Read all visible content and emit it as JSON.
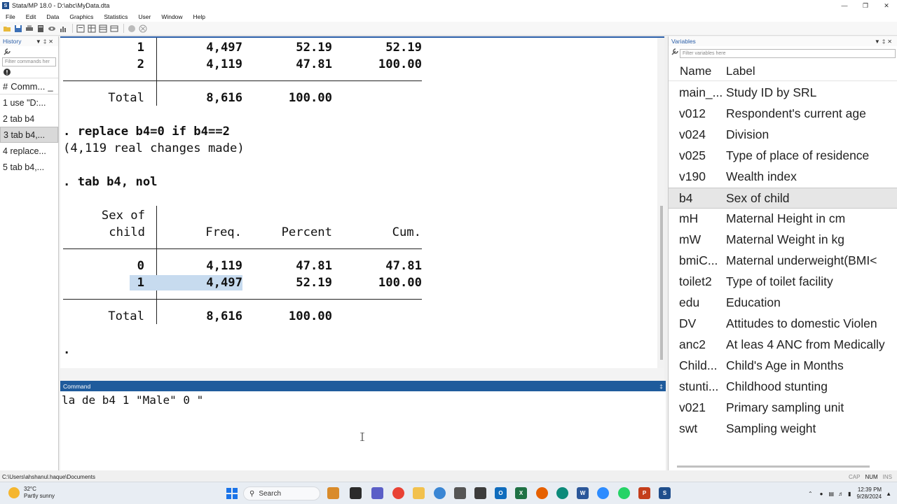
{
  "window": {
    "title": "Stata/MP 18.0 - D:\\abc\\MyData.dta"
  },
  "menu": [
    "File",
    "Edit",
    "Data",
    "Graphics",
    "Statistics",
    "User",
    "Window",
    "Help"
  ],
  "history": {
    "title": "History",
    "filter_placeholder": "Filter commands her",
    "col_num": "#",
    "col_cmd": "Comm...",
    "col_extra": "_",
    "items": [
      {
        "num": "1",
        "cmd": "use \"D:..."
      },
      {
        "num": "2",
        "cmd": "tab b4"
      },
      {
        "num": "3",
        "cmd": "tab b4,..."
      },
      {
        "num": "4",
        "cmd": "replace..."
      },
      {
        "num": "5",
        "cmd": "tab b4,..."
      }
    ]
  },
  "results": {
    "table1": {
      "rows": [
        {
          "val": "1",
          "freq": "4,497",
          "pct": "52.19",
          "cum": "52.19"
        },
        {
          "val": "2",
          "freq": "4,119",
          "pct": "47.81",
          "cum": "100.00"
        }
      ],
      "total_label": "Total",
      "total_freq": "8,616",
      "total_pct": "100.00"
    },
    "cmd_replace": ". replace b4=0 if b4==2",
    "replace_output": "(4,119 real changes made)",
    "cmd_tab": ". tab b4, nol",
    "table2": {
      "var_label_line1": "Sex of",
      "var_label_line2": "child",
      "col_freq": "Freq.",
      "col_pct": "Percent",
      "col_cum": "Cum.",
      "rows": [
        {
          "val": "0",
          "freq": "4,119",
          "pct": "47.81",
          "cum": "47.81"
        },
        {
          "val": "1",
          "freq": "4,497",
          "pct": "52.19",
          "cum": "100.00"
        }
      ],
      "total_label": "Total",
      "total_freq": "8,616",
      "total_pct": "100.00"
    },
    "prompt": "."
  },
  "command": {
    "title": "Command",
    "text": "la de b4 1 \"Male\" 0 \""
  },
  "variables": {
    "title": "Variables",
    "filter_placeholder": "Filter variables here",
    "col_name": "Name",
    "col_label": "Label",
    "items": [
      {
        "name": "main_...",
        "label": "Study ID by SRL"
      },
      {
        "name": "v012",
        "label": "Respondent's current age"
      },
      {
        "name": "v024",
        "label": "Division"
      },
      {
        "name": "v025",
        "label": "Type of place of residence"
      },
      {
        "name": "v190",
        "label": "Wealth index"
      },
      {
        "name": "b4",
        "label": "Sex of child"
      },
      {
        "name": "mH",
        "label": "Maternal Height in cm"
      },
      {
        "name": "mW",
        "label": "Maternal Weight in kg"
      },
      {
        "name": "bmiC...",
        "label": "Maternal underweight(BMI<"
      },
      {
        "name": "toilet2",
        "label": "Type of toilet facility"
      },
      {
        "name": "edu",
        "label": "Education"
      },
      {
        "name": "DV",
        "label": "Attitudes to domestic Violen"
      },
      {
        "name": "anc2",
        "label": "At leas 4 ANC from Medically"
      },
      {
        "name": "Child...",
        "label": "Child's Age in Months"
      },
      {
        "name": "stunti...",
        "label": "Childhood stunting"
      },
      {
        "name": "v021",
        "label": "Primary sampling unit"
      },
      {
        "name": "swt",
        "label": "Sampling weight"
      }
    ]
  },
  "statusbar": {
    "path": "C:\\Users\\ahshanul.haque\\Documents",
    "cap": "CAP",
    "num": "NUM",
    "ins": "INS"
  },
  "taskbar": {
    "temp": "32°C",
    "weather": "Partly sunny",
    "search": "Search",
    "time": "12:39 PM",
    "date": "9/28/2024"
  }
}
